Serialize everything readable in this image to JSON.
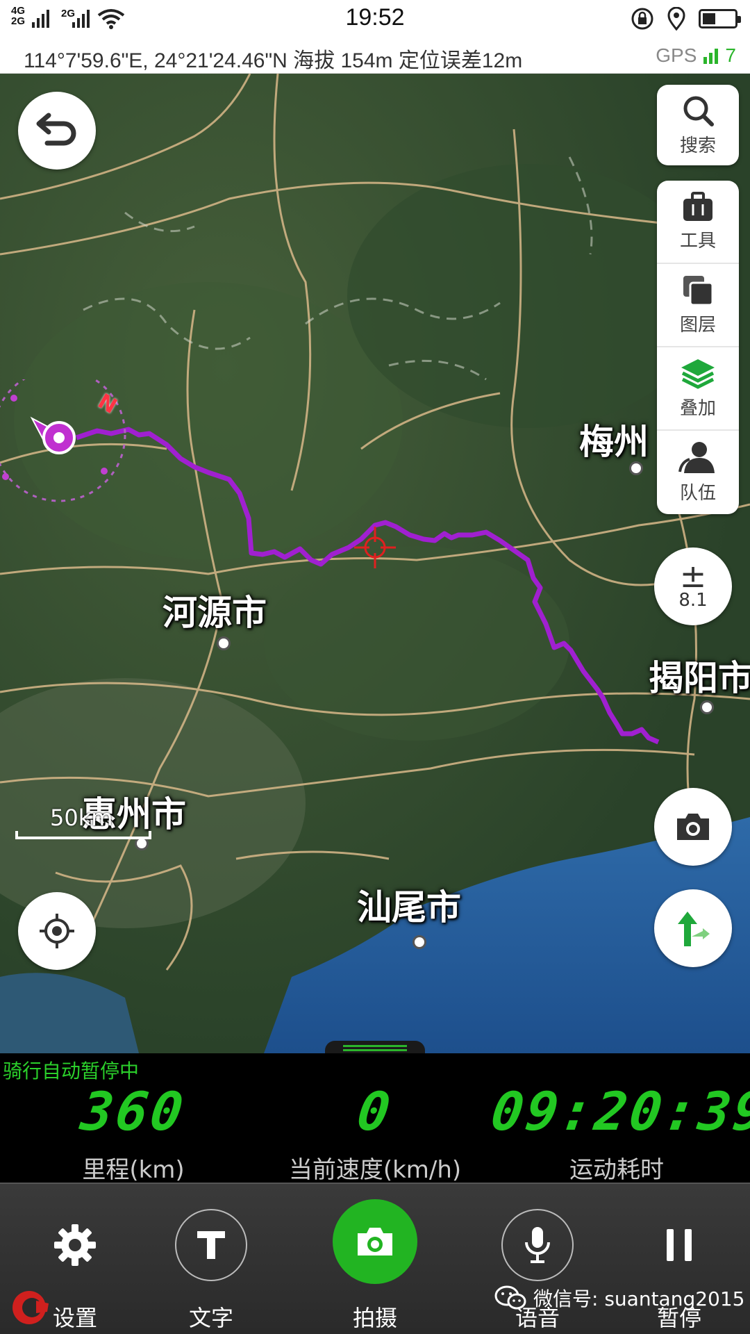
{
  "status_bar": {
    "network_top": "4G",
    "network_bottom": "2G",
    "network_secondary": "2G",
    "time": "19:52",
    "icons": [
      "signal-icon",
      "wifi-icon",
      "rotation-lock-icon",
      "location-icon",
      "battery-icon"
    ]
  },
  "info_bar": {
    "coordinates": "114°7'59.6\"E, 24°21'24.46\"N  海拔 154m  定位误差12m",
    "gps_label": "GPS",
    "gps_count": "7"
  },
  "map": {
    "cities": {
      "meizhou": "梅州",
      "heyuan": "河源市",
      "jieyang": "揭阳市",
      "huizhou": "惠州市",
      "shanwei": "汕尾市"
    },
    "compass_letter": "N",
    "scale_label": "50km",
    "route_color": "#a020d0"
  },
  "side_panel": {
    "search": "搜索",
    "tools": "工具",
    "layers": "图层",
    "overlay": "叠加",
    "team": "队伍"
  },
  "zoom": {
    "level": "8.1"
  },
  "stats": {
    "status": "骑行自动暂停中",
    "distance": {
      "value": "360",
      "label": "里程(km)"
    },
    "speed": {
      "value": "0",
      "label": "当前速度(km/h)"
    },
    "duration": {
      "value": "09:20:39",
      "label": "运动耗时"
    }
  },
  "toolbar": {
    "settings": "设置",
    "text": "文字",
    "capture": "拍摄",
    "voice": "语音",
    "pause": "暂停"
  },
  "watermark": "微信号: suantang2015",
  "colors": {
    "accent_green": "#22b422",
    "route": "#a020d0"
  }
}
